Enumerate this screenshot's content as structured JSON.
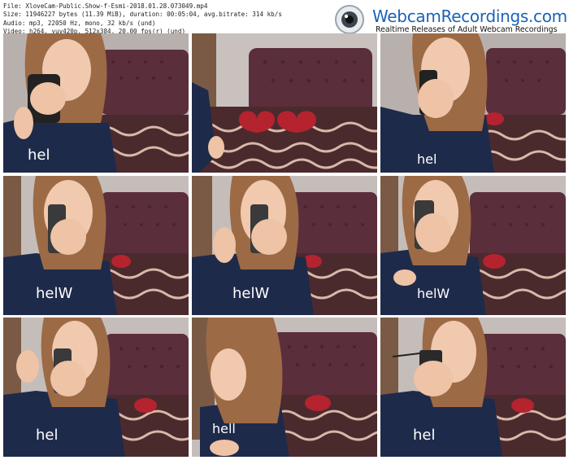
{
  "info": {
    "file": "File: XloveCam-Public.Show-f-Esmi-2018.01.28.073049.mp4",
    "size": "Size: 11946227 bytes (11.39 MiB), duration: 00:05:04, avg.bitrate: 314 kb/s",
    "audio": "Audio: mp3, 22050 Hz, mono, 32 kb/s (und)",
    "video": "Video: h264, yuv420p, 512x384, 20.00 fps(r) (und)"
  },
  "brand": {
    "site": "WebcamRecordings.com",
    "tagline": "Realtime Releases of Adult Webcam Recordings",
    "icon": "webcam-icon"
  },
  "thumbnails": [
    {
      "index": 1,
      "scene": "phone-close"
    },
    {
      "index": 2,
      "scene": "bed-hearts"
    },
    {
      "index": 3,
      "scene": "phone-close"
    },
    {
      "index": 4,
      "scene": "mirror-face"
    },
    {
      "index": 5,
      "scene": "mirror-face"
    },
    {
      "index": 6,
      "scene": "mirror-face"
    },
    {
      "index": 7,
      "scene": "mirror-face"
    },
    {
      "index": 8,
      "scene": "looking-down"
    },
    {
      "index": 9,
      "scene": "mirror-face"
    }
  ]
}
